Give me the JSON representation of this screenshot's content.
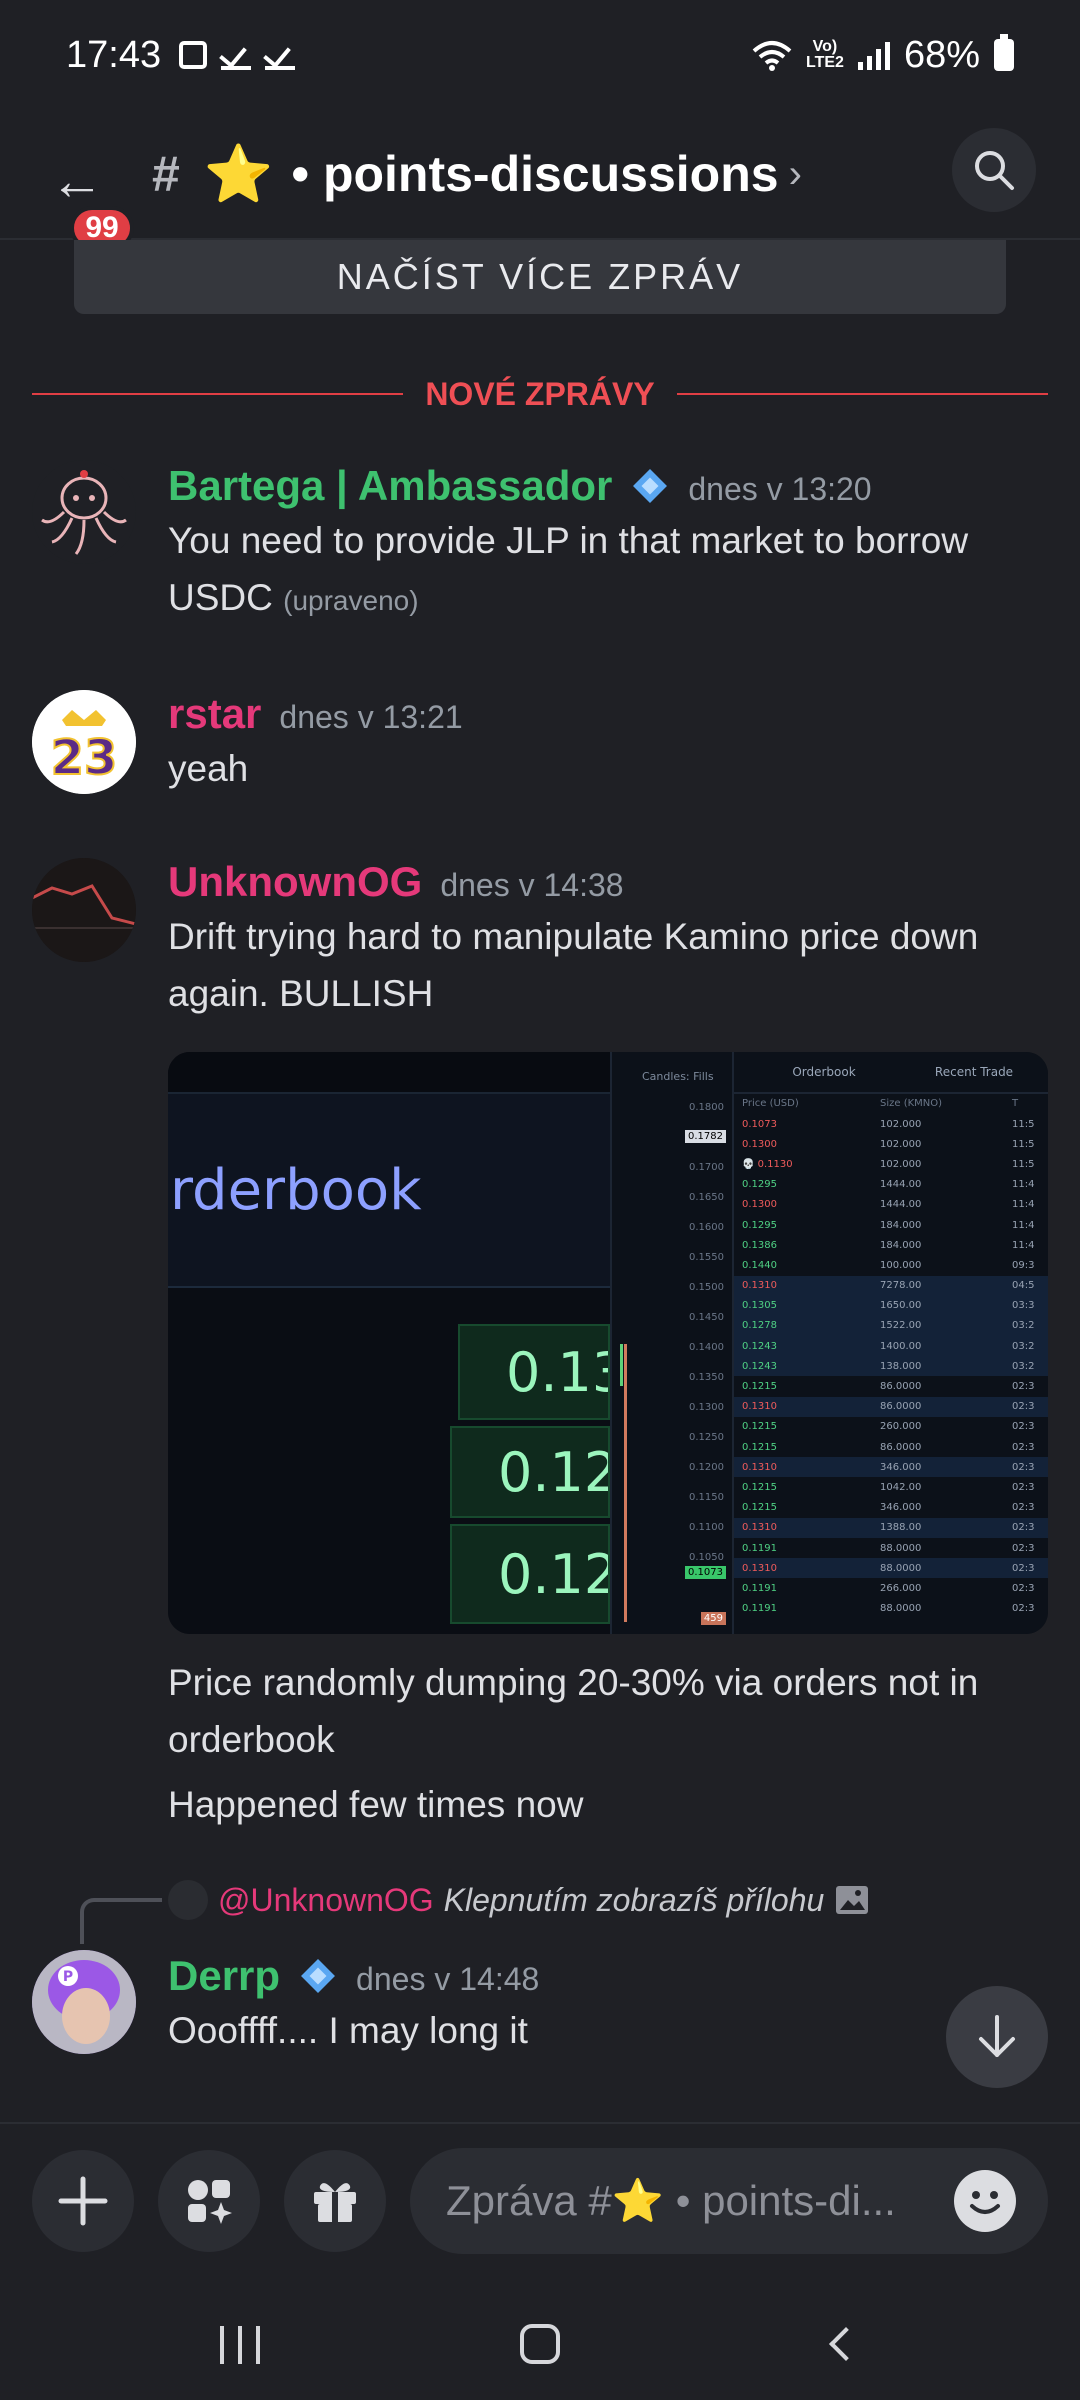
{
  "status_bar": {
    "time": "17:43",
    "battery": "68%",
    "network": "LTE2",
    "volte": "Vo)"
  },
  "header": {
    "back_badge": "99",
    "channel_emoji": "⭐",
    "channel_title": "• points-discussions",
    "chevron": "›"
  },
  "load_more": "NAČÍST VÍCE ZPRÁV",
  "new_divider": "NOVÉ ZPRÁVY",
  "messages": [
    {
      "author": "Bartega | Ambassador",
      "author_color": "#3ec16f",
      "time": "dnes v 13:20",
      "lines": [
        "You need to provide JLP in that market to borrow",
        "USDC"
      ],
      "edited": "(upraveno)"
    },
    {
      "author": "rstar",
      "author_color": "#e5397a",
      "time": "dnes v 13:21",
      "lines": [
        "yeah"
      ]
    },
    {
      "author": "UnknownOG",
      "author_color": "#e5397a",
      "time": "dnes v 14:38",
      "lines": [
        "Drift trying hard to manipulate Kamino price down",
        "again. BULLISH"
      ],
      "after_attachment": [
        "Price randomly dumping 20-30% via orders not in",
        "orderbook",
        "Happened few times now"
      ]
    },
    {
      "author": "Derrp",
      "author_color": "#3ec16f",
      "time": "dnes v 14:48",
      "lines": [
        "Oooffff.... I may long it"
      ],
      "reply_to": "@UnknownOG",
      "reply_hint": "Klepnutím zobrazíš přílohu"
    }
  ],
  "attachment": {
    "left_title": "rderbook",
    "big_cells": [
      "0.13",
      "0.12",
      "0.12"
    ],
    "mid_header": "Candles: Fills",
    "price_ticks": [
      "0.1800",
      "0.1750",
      "0.1700",
      "0.1650",
      "0.1600",
      "0.1550",
      "0.1500",
      "0.1450",
      "0.1400",
      "0.1350",
      "0.1300",
      "0.1250",
      "0.1200",
      "0.1150",
      "0.1100",
      "0.1050"
    ],
    "price_tag_top": "0.1782",
    "price_tag_bottom": "0.1073",
    "volume_tag": "459",
    "tabs": [
      "Orderbook",
      "Recent Trade"
    ],
    "columns": [
      "Price (USD)",
      "Size (KMNO)",
      "T"
    ],
    "rows": [
      {
        "p": "0.1073",
        "s": "102.000",
        "t": "11:5",
        "dir": "dn",
        "hl": false
      },
      {
        "p": "0.1300",
        "s": "102.000",
        "t": "11:5",
        "dir": "dn",
        "hl": false
      },
      {
        "p": "💀 0.1130",
        "s": "102.000",
        "t": "11:5",
        "dir": "dn",
        "hl": false
      },
      {
        "p": "0.1295",
        "s": "1444.00",
        "t": "11:4",
        "dir": "up",
        "hl": false
      },
      {
        "p": "0.1300",
        "s": "1444.00",
        "t": "11:4",
        "dir": "dn",
        "hl": false
      },
      {
        "p": "0.1295",
        "s": "184.000",
        "t": "11:4",
        "dir": "up",
        "hl": false
      },
      {
        "p": "0.1386",
        "s": "184.000",
        "t": "11:4",
        "dir": "up",
        "hl": false
      },
      {
        "p": "0.1440",
        "s": "100.000",
        "t": "09:3",
        "dir": "up",
        "hl": false
      },
      {
        "p": "0.1310",
        "s": "7278.00",
        "t": "04:5",
        "dir": "dn",
        "hl": true
      },
      {
        "p": "0.1305",
        "s": "1650.00",
        "t": "03:3",
        "dir": "up",
        "hl": true
      },
      {
        "p": "0.1278",
        "s": "1522.00",
        "t": "03:2",
        "dir": "up",
        "hl": true
      },
      {
        "p": "0.1243",
        "s": "1400.00",
        "t": "03:2",
        "dir": "up",
        "hl": true
      },
      {
        "p": "0.1243",
        "s": "138.000",
        "t": "03:2",
        "dir": "up",
        "hl": true
      },
      {
        "p": "0.1215",
        "s": "86.0000",
        "t": "02:3",
        "dir": "up",
        "hl": false
      },
      {
        "p": "0.1310",
        "s": "86.0000",
        "t": "02:3",
        "dir": "dn",
        "hl": true
      },
      {
        "p": "0.1215",
        "s": "260.000",
        "t": "02:3",
        "dir": "up",
        "hl": false
      },
      {
        "p": "0.1215",
        "s": "86.0000",
        "t": "02:3",
        "dir": "up",
        "hl": false
      },
      {
        "p": "0.1310",
        "s": "346.000",
        "t": "02:3",
        "dir": "dn",
        "hl": true
      },
      {
        "p": "0.1215",
        "s": "1042.00",
        "t": "02:3",
        "dir": "up",
        "hl": false
      },
      {
        "p": "0.1215",
        "s": "346.000",
        "t": "02:3",
        "dir": "up",
        "hl": false
      },
      {
        "p": "0.1310",
        "s": "1388.00",
        "t": "02:3",
        "dir": "dn",
        "hl": true
      },
      {
        "p": "0.1191",
        "s": "88.0000",
        "t": "02:3",
        "dir": "up",
        "hl": false
      },
      {
        "p": "0.1310",
        "s": "88.0000",
        "t": "02:3",
        "dir": "dn",
        "hl": true
      },
      {
        "p": "0.1191",
        "s": "266.000",
        "t": "02:3",
        "dir": "up",
        "hl": false
      },
      {
        "p": "0.1191",
        "s": "88.0000",
        "t": "02:3",
        "dir": "up",
        "hl": false
      }
    ]
  },
  "composer": {
    "placeholder": "Zpráva #⭐ • points-di..."
  },
  "colors": {
    "accent_red": "#e03e44",
    "green_name": "#3ec16f",
    "pink_name": "#e5397a"
  }
}
